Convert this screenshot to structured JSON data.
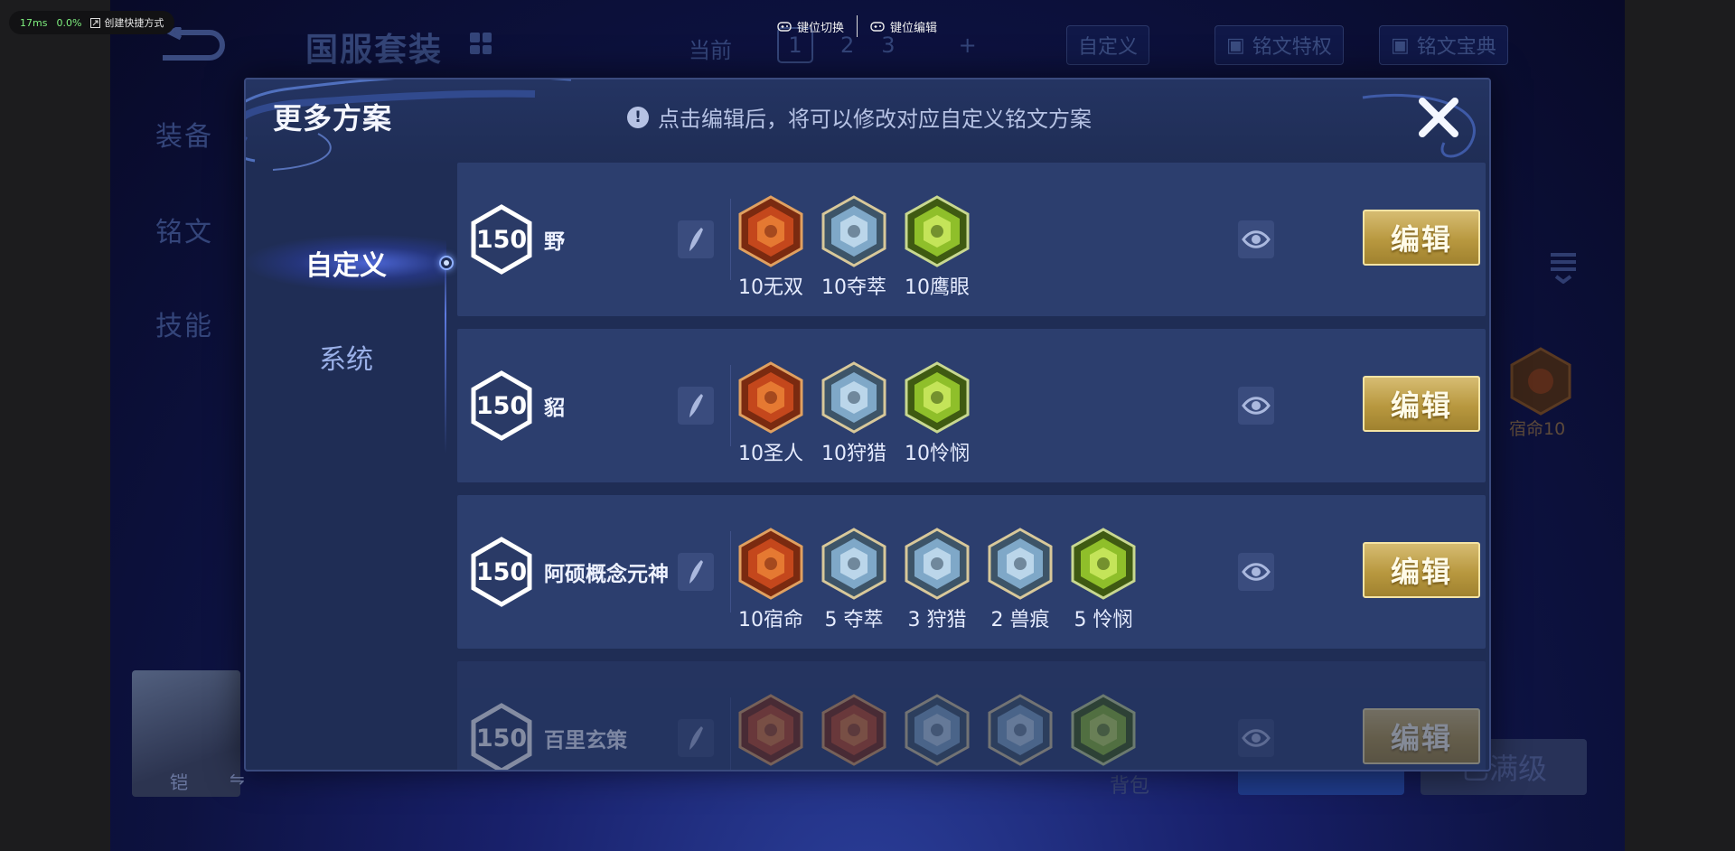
{
  "overlay": {
    "latency": "17ms",
    "loss": "0.0%",
    "shortcut": "创建快捷方式"
  },
  "keybar": {
    "switch_label": "键位切换",
    "edit_label": "键位编辑"
  },
  "background": {
    "title": "国服套装",
    "current_label": "当前",
    "pages": [
      "1",
      "2",
      "3",
      "+"
    ],
    "tabs": {
      "custom": "自定义",
      "privilege": "铭文特权",
      "codex": "铭文宝典"
    },
    "left_nav": [
      "装备",
      "铭文",
      "技能"
    ],
    "hero_name": "铠",
    "hero_switch": "⇋",
    "bag": "背包",
    "max_level": "已满级",
    "side_rune_label": "宿命10"
  },
  "modal": {
    "title": "更多方案",
    "notice": "点击编辑后，将可以修改对应自定义铭文方案",
    "nav": [
      {
        "label": "自定义",
        "active": true
      },
      {
        "label": "系统",
        "active": false
      }
    ],
    "edit_label": "编辑",
    "schemes": [
      {
        "level": "150",
        "name": "野",
        "runes": [
          {
            "label": "10无双",
            "color": "red",
            "icon": "wushuang-rune-icon"
          },
          {
            "label": "10夺萃",
            "color": "blue",
            "icon": "duocui-rune-icon"
          },
          {
            "label": "10鹰眼",
            "color": "green",
            "icon": "yingyan-rune-icon"
          }
        ]
      },
      {
        "level": "150",
        "name": "貂",
        "runes": [
          {
            "label": "10圣人",
            "color": "red",
            "icon": "shengren-rune-icon"
          },
          {
            "label": "10狩猎",
            "color": "blue",
            "icon": "shoulie-rune-icon"
          },
          {
            "label": "10怜悯",
            "color": "green",
            "icon": "lianmin-rune-icon"
          }
        ]
      },
      {
        "level": "150",
        "name": "阿硕概念元神",
        "runes": [
          {
            "label": "10宿命",
            "color": "red",
            "icon": "suming-rune-icon"
          },
          {
            "label": "5 夺萃",
            "color": "blue",
            "icon": "duocui-rune-icon"
          },
          {
            "label": "3 狩猎",
            "color": "blue",
            "icon": "shoulie-rune-icon"
          },
          {
            "label": "2 兽痕",
            "color": "blue",
            "icon": "shouhen-rune-icon"
          },
          {
            "label": "5 怜悯",
            "color": "green",
            "icon": "lianmin-rune-icon"
          }
        ]
      },
      {
        "level": "150",
        "name": "百里玄策",
        "runes": [
          {
            "label": "",
            "color": "red",
            "icon": "red-rune-icon"
          },
          {
            "label": "",
            "color": "red",
            "icon": "red-rune-icon"
          },
          {
            "label": "",
            "color": "blue",
            "icon": "blue-rune-icon"
          },
          {
            "label": "",
            "color": "blue",
            "icon": "blue-rune-icon"
          },
          {
            "label": "",
            "color": "green",
            "icon": "green-rune-icon"
          }
        ]
      }
    ]
  },
  "colors": {
    "red_rune": "#c4471c",
    "blue_rune": "#7fa8c8",
    "green_rune": "#8fbf2a",
    "gold_button": "#c8a94f",
    "panel": "#1f2d55",
    "row": "#2c3e6e"
  }
}
